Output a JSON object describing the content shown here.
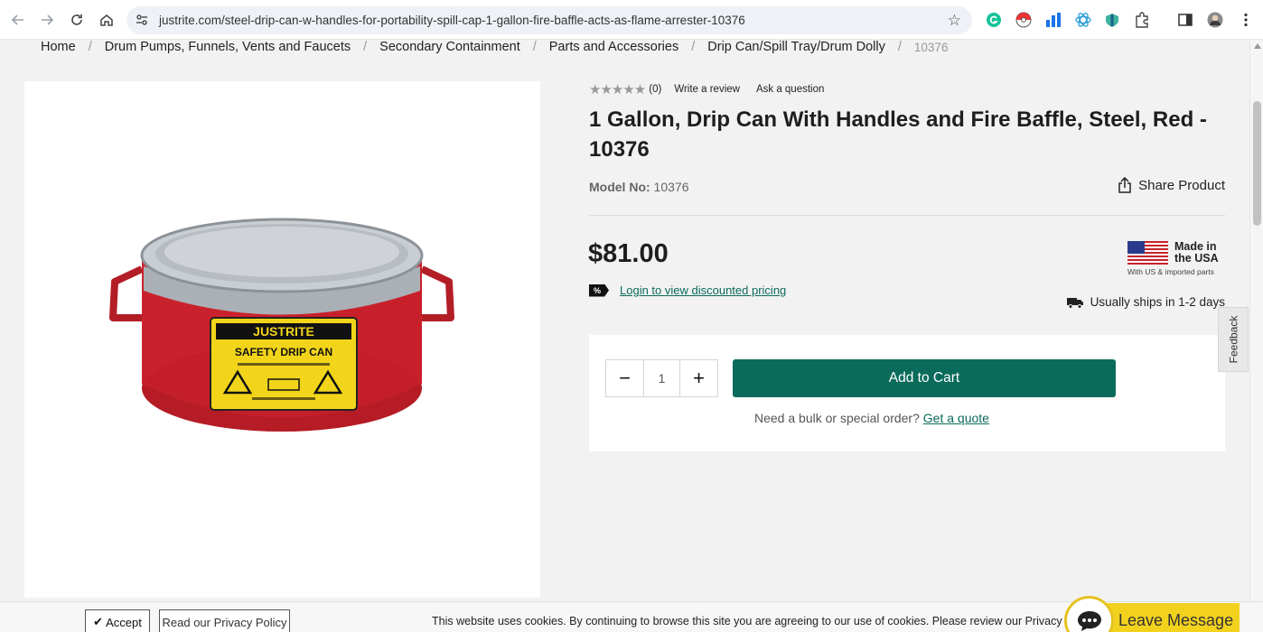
{
  "browser": {
    "url": "justrite.com/steel-drip-can-w-handles-for-portability-spill-cap-1-gallon-fire-baffle-acts-as-flame-arrester-10376"
  },
  "breadcrumb": [
    "Home",
    "Drum Pumps, Funnels, Vents and Faucets",
    "Secondary Containment",
    "Parts and Accessories",
    "Drip Can/Spill Tray/Drum Dolly",
    "10376"
  ],
  "product": {
    "rating_count": "(0)",
    "write_review": "Write a review",
    "ask_question": "Ask a question",
    "title": "1 Gallon, Drip Can With Handles and Fire Baffle, Steel, Red - 10376",
    "model_label": "Model No:",
    "model_value": "10376",
    "share_label": "Share Product",
    "price": "$81.00",
    "discount_link": "Login to view discounted pricing",
    "made_in_line1": "Made in",
    "made_in_line2": "the USA",
    "made_in_sub": "With US & imported parts",
    "shipping": "Usually ships in 1-2 days",
    "quantity": "1",
    "add_to_cart": "Add to Cart",
    "quote_text": "Need a bulk or special order?",
    "quote_link": "Get a quote",
    "can_label_brand": "JUSTRITE",
    "can_label_title": "SAFETY DRIP CAN"
  },
  "feedback": "Feedback",
  "cookie": {
    "accept": "Accept",
    "privacy": "Read our Privacy Policy",
    "text": "This website uses cookies. By continuing to browse this site you are agreeing to our use of cookies. Please review our Privacy Policy"
  },
  "chat": {
    "label": "Leave Message"
  },
  "colors": {
    "accent": "#0a6b5a",
    "chat_yellow": "#f3d21e",
    "can_red": "#c8202a"
  }
}
